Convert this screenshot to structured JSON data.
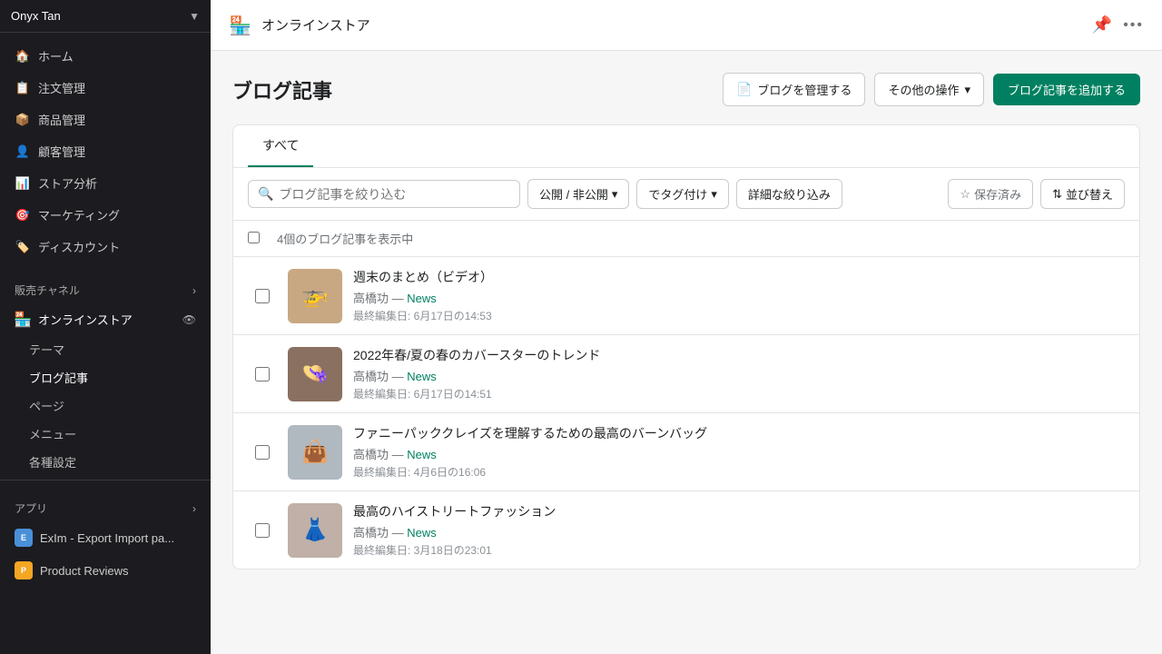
{
  "sidebar": {
    "store": {
      "name": "Onyx Tan",
      "arrow": "▼"
    },
    "nav": [
      {
        "id": "home",
        "label": "ホーム",
        "icon": "🏠"
      },
      {
        "id": "orders",
        "label": "注文管理",
        "icon": "📋"
      },
      {
        "id": "products",
        "label": "商品管理",
        "icon": "📦"
      },
      {
        "id": "customers",
        "label": "顧客管理",
        "icon": "👤"
      },
      {
        "id": "analytics",
        "label": "ストア分析",
        "icon": "📊"
      },
      {
        "id": "marketing",
        "label": "マーケティング",
        "icon": "🎯"
      },
      {
        "id": "discounts",
        "label": "ディスカウント",
        "icon": "🏷️"
      }
    ],
    "sales_channels_label": "販売チャネル",
    "online_store": "オンラインストア",
    "sub_items": [
      {
        "id": "theme",
        "label": "テーマ"
      },
      {
        "id": "blog",
        "label": "ブログ記事",
        "active": true
      },
      {
        "id": "pages",
        "label": "ページ"
      },
      {
        "id": "menu",
        "label": "メニュー"
      },
      {
        "id": "settings",
        "label": "各種設定"
      }
    ],
    "apps_label": "アプリ",
    "apps": [
      {
        "id": "exim",
        "label": "ExIm - Export Import pa...",
        "icon": "E"
      },
      {
        "id": "reviews",
        "label": "Product Reviews",
        "icon": "P"
      }
    ]
  },
  "topbar": {
    "store_icon": "🏪",
    "title": "オンラインストア"
  },
  "page": {
    "title": "ブログ記事",
    "btn_manage": "ブログを管理する",
    "btn_other": "その他の操作",
    "btn_add": "ブログ記事を追加する",
    "tabs": [
      {
        "id": "all",
        "label": "すべて",
        "active": true
      }
    ],
    "search_placeholder": "ブログ記事を絞り込む",
    "filter_publish": "公開 / 非公開",
    "filter_tags": "でタグ付け",
    "filter_detail": "詳細な絞り込み",
    "btn_save": "保存済み",
    "btn_sort": "並び替え",
    "count_label": "4個のブログ記事を表示中",
    "articles": [
      {
        "id": 1,
        "title": "週末のまとめ（ビデオ）",
        "author": "高橋功",
        "blog": "News",
        "date": "最終編集日: 6月17日の14:53",
        "thumb_color": "#c8a882",
        "thumb_emoji": "🚁"
      },
      {
        "id": 2,
        "title": "2022年春/夏の春のカバースターのトレンド",
        "author": "高橋功",
        "blog": "News",
        "date": "最終編集日: 6月17日の14:51",
        "thumb_color": "#8a7060",
        "thumb_emoji": "👒"
      },
      {
        "id": 3,
        "title": "ファニーパッククレイズを理解するための最高のバーンバッグ",
        "author": "高橋功",
        "blog": "News",
        "date": "最終編集日: 4月6日の16:06",
        "thumb_color": "#b0b8c0",
        "thumb_emoji": "👜"
      },
      {
        "id": 4,
        "title": "最高のハイストリートファッション",
        "author": "高橋功",
        "blog": "News",
        "date": "最終編集日: 3月18日の23:01",
        "thumb_color": "#c0b0a8",
        "thumb_emoji": "👗"
      }
    ]
  }
}
